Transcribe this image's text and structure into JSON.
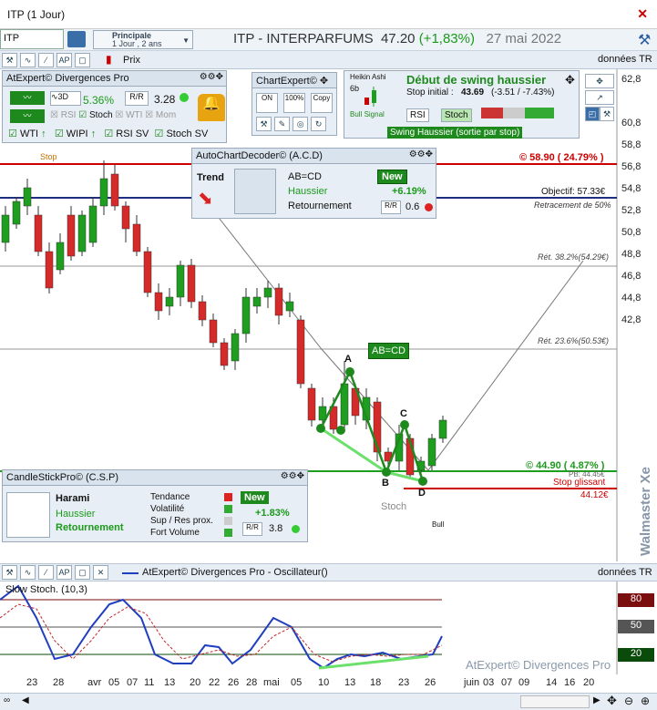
{
  "window": {
    "title": "ITP (1 Jour)"
  },
  "toolbar": {
    "symbol": "ITP",
    "workspace": "Principale",
    "workspace_sub": "1 Jour , 2 ans",
    "headline_name": "ITP - INTERPARFUMS",
    "headline_price": "47.20",
    "headline_change": "(+1,83%)",
    "headline_date": "27 mai 2022",
    "prix_label": "Prix",
    "donnees_label": "données TR"
  },
  "atexpert": {
    "title": "AtExpert© Divergences Pro",
    "pct": "5.36%",
    "value": "3.28",
    "checks": {
      "rsi": "RSI",
      "stoch": "Stoch",
      "wti": "WTI",
      "mom": "Mom"
    },
    "row2": {
      "wti": "WTI",
      "wipi": "WIPI",
      "rsi_sv": "RSI SV",
      "stoch_sv": "Stoch SV"
    }
  },
  "chartexpert": {
    "title": "ChartExpert©",
    "on": "ON",
    "pct100": "100%",
    "copy": "Copy"
  },
  "heikin": {
    "label": "Heikin Ashi",
    "sub": "6b",
    "bull": "Bull Signal",
    "headline": "Début de swing haussier",
    "stop_label": "Stop initial :",
    "stop_value": "43.69",
    "stop_diff": "(-3.51 / -7.43%)",
    "rsi": "RSI",
    "stoch": "Stoch",
    "banner": "Swing Haussier (sortie par stop)"
  },
  "acd": {
    "title": "AutoChartDecoder© (A.C.D)",
    "trend": "Trend",
    "pattern": "AB=CD",
    "direction": "Haussier",
    "type": "Retournement",
    "badge": "New",
    "pct": "+6.19%",
    "rr": "0.6"
  },
  "csp": {
    "title": "CandleStickPro© (C.S.P)",
    "pattern": "Harami",
    "direction": "Haussier",
    "type": "Retournement",
    "labels": [
      "Tendance",
      "Volatilité",
      "Sup / Res prox.",
      "Fort Volume"
    ],
    "badge": "New",
    "pct": "+1.83%",
    "rr": "3.8"
  },
  "chart_annotations": {
    "stop": "Stop",
    "top_level": "© 58.90 ( 24.79% )",
    "objectif": "Objectif: 57.33€",
    "retr50": "Retracement de 50%",
    "ret382": "Rét. 38.2%(54.29€)",
    "ret236": "Rét. 23.6%(50.53€)",
    "abcd": "AB=CD",
    "low_level": "© 44.90 ( 4.87% )",
    "pb": "PB: 44.45€",
    "stop_glissant": "Stop glissant",
    "stop_val": "44.12€",
    "stoch": "Stoch",
    "bull": "Bull",
    "a": "A",
    "b": "B",
    "c": "C",
    "d": "D",
    "watermark": "Walmaster Xe"
  },
  "osc": {
    "title": "AtExpert© Divergences Pro - Oscillateur()",
    "donnees": "données TR",
    "label": "Slow Stoch. (10,3)",
    "levels": [
      "80",
      "50",
      "20"
    ],
    "watermark": "AtExpert© Divergences Pro"
  },
  "chart_data": {
    "type": "candlestick",
    "y_ticks": [
      "60,8",
      "58,8",
      "56,8",
      "54,8",
      "52,8",
      "50,8",
      "48,8",
      "46,8",
      "44,8",
      "42,8"
    ],
    "y_top_label": "62,8",
    "x_ticks": [
      "23",
      "28",
      "avr",
      "05",
      "07",
      "11",
      "13",
      "20",
      "22",
      "26",
      "28",
      "mai",
      "05",
      "10",
      "13",
      "18",
      "23",
      "26",
      "juin",
      "03",
      "07",
      "09",
      "14",
      "16",
      "20"
    ],
    "ylim": [
      41.5,
      62.8
    ]
  },
  "colors": {
    "up": "#1e9e1e",
    "down": "#d42a2a",
    "bg": "#ffffff",
    "panel": "#e8eef5",
    "accent": "#1f4f8f"
  }
}
